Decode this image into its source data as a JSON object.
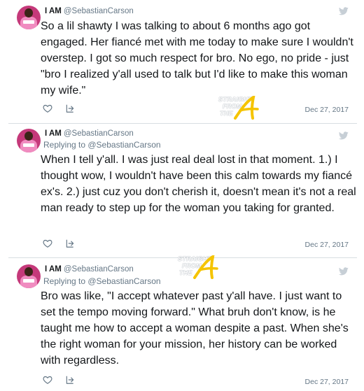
{
  "colors": {
    "text": "#14171a",
    "muted": "#657786",
    "divider": "#d8dee2",
    "avatar_bg": "#c5397a",
    "watermark_accent": "#f5c400"
  },
  "tweets": [
    {
      "name": "I AM",
      "handle": "@SebastianCarson",
      "text": "So a lil shawty I was talking to about 6 months ago got engaged. Her fiancé met with me today to make sure I wouldn't overstep. I got so much respect for bro. No ego, no pride - just \"bro I realized y'all used to talk but I'd like to make this woman my wife.\"",
      "date": "Dec 27, 2017",
      "icons": [
        "twitter-bird-icon",
        "heart-icon",
        "share-icon"
      ]
    },
    {
      "name": "I AM",
      "handle": "@SebastianCarson",
      "replying_to": "Replying to @SebastianCarson",
      "text": "When I tell y'all. I was just real deal lost in that moment. 1.) I thought wow, I wouldn't have been this calm towards my fiancé ex's. 2.) just cuz you don't cherish it, doesn't mean it's not a real man ready to step up for the woman you taking for granted.",
      "date": "Dec 27, 2017",
      "icons": [
        "twitter-bird-icon",
        "heart-icon",
        "share-icon"
      ]
    },
    {
      "name": "I AM",
      "handle": "@SebastianCarson",
      "replying_to": "Replying to @SebastianCarson",
      "text": "Bro was like, \"I accept whatever past y'all have. I just want to set the tempo moving forward.\" What bruh don't know, is he taught me how to accept a woman despite a past. When she's the right woman for your mission, her history can be worked with regardless.",
      "date": "Dec 27, 2017",
      "icons": [
        "twitter-bird-icon",
        "heart-icon",
        "share-icon"
      ]
    }
  ],
  "watermark": {
    "line1": "STRAIGHT",
    "line2": "FROM",
    "line3": "THE"
  }
}
